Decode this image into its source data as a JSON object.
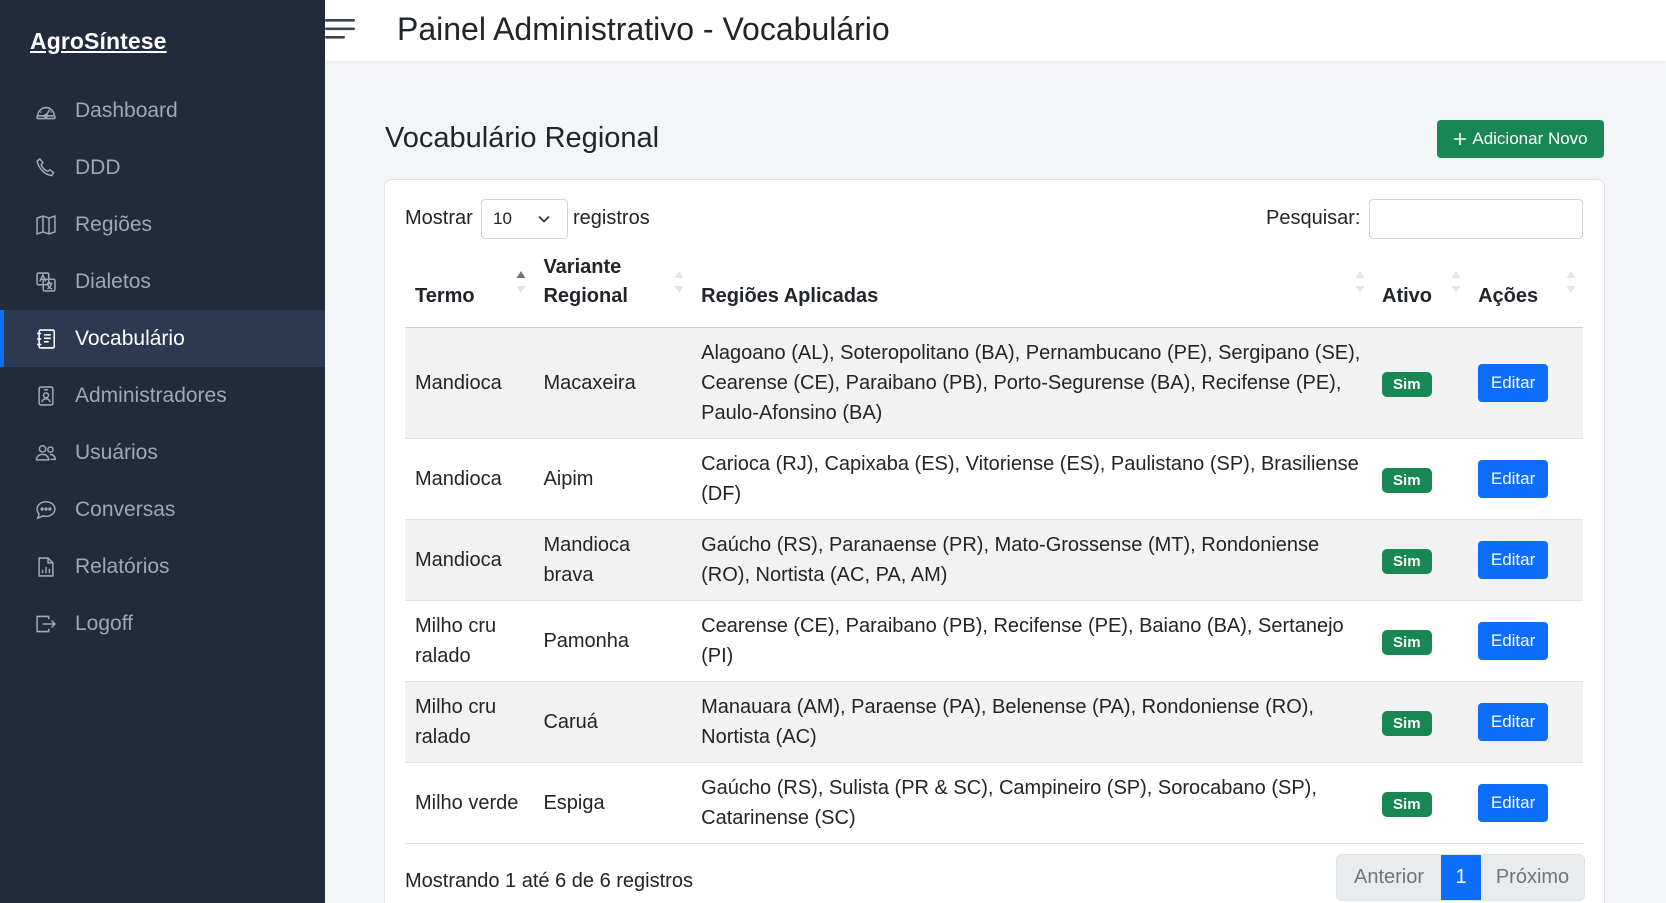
{
  "brand": "AgroSíntese",
  "header": {
    "title": "Painel Administrativo - Vocabulário"
  },
  "nav": [
    {
      "label": "Dashboard",
      "icon": "speedometer-icon"
    },
    {
      "label": "DDD",
      "icon": "phone-icon"
    },
    {
      "label": "Regiões",
      "icon": "map-icon"
    },
    {
      "label": "Dialetos",
      "icon": "translate-icon"
    },
    {
      "label": "Vocabulário",
      "icon": "journal-text-icon",
      "active": true
    },
    {
      "label": "Administradores",
      "icon": "person-badge-icon"
    },
    {
      "label": "Usuários",
      "icon": "people-icon"
    },
    {
      "label": "Conversas",
      "icon": "chat-dots-icon"
    },
    {
      "label": "Relatórios",
      "icon": "file-bar-chart-icon"
    },
    {
      "label": "Logoff",
      "icon": "box-arrow-right-icon"
    }
  ],
  "page": {
    "heading": "Vocabulário Regional",
    "add_button": "Adicionar Novo"
  },
  "table_controls": {
    "length_prefix": "Mostrar",
    "length_value": "10",
    "length_suffix": "registros",
    "search_label": "Pesquisar:",
    "search_value": ""
  },
  "table": {
    "columns": [
      "Termo",
      "Variante Regional",
      "Regiões Aplicadas",
      "Ativo",
      "Ações"
    ],
    "rows": [
      {
        "termo": "Mandioca",
        "variante": "Macaxeira",
        "regioes": "Alagoano (AL), Soteropolitano (BA), Pernambucano (PE), Sergipano (SE), Cearense (CE), Paraibano (PB), Porto-Segurense (BA), Recifense (PE), Paulo-Afonsino (BA)",
        "ativo": "Sim",
        "acao": "Editar"
      },
      {
        "termo": "Mandioca",
        "variante": "Aipim",
        "regioes": "Carioca (RJ), Capixaba (ES), Vitoriense (ES), Paulistano (SP), Brasiliense (DF)",
        "ativo": "Sim",
        "acao": "Editar"
      },
      {
        "termo": "Mandioca",
        "variante": "Mandioca brava",
        "regioes": "Gaúcho (RS), Paranaense (PR), Mato-Grossense (MT), Rondoniense (RO), Nortista (AC, PA, AM)",
        "ativo": "Sim",
        "acao": "Editar"
      },
      {
        "termo": "Milho cru ralado",
        "variante": "Pamonha",
        "regioes": "Cearense (CE), Paraibano (PB), Recifense (PE), Baiano (BA), Sertanejo (PI)",
        "ativo": "Sim",
        "acao": "Editar"
      },
      {
        "termo": "Milho cru ralado",
        "variante": "Caruá",
        "regioes": "Manauara (AM), Paraense (PA), Belenense (PA), Rondoniense (RO), Nortista (AC)",
        "ativo": "Sim",
        "acao": "Editar"
      },
      {
        "termo": "Milho verde",
        "variante": "Espiga",
        "regioes": "Gaúcho (RS), Sulista (PR & SC), Campineiro (SP), Sorocabano (SP), Catarinense (SC)",
        "ativo": "Sim",
        "acao": "Editar"
      }
    ]
  },
  "footer": {
    "info": "Mostrando 1 até 6 de 6 registros",
    "prev": "Anterior",
    "current_page": "1",
    "next": "Próximo"
  },
  "colors": {
    "sidebar": "#212b3c",
    "primary": "#0d6efd",
    "success": "#198754"
  }
}
